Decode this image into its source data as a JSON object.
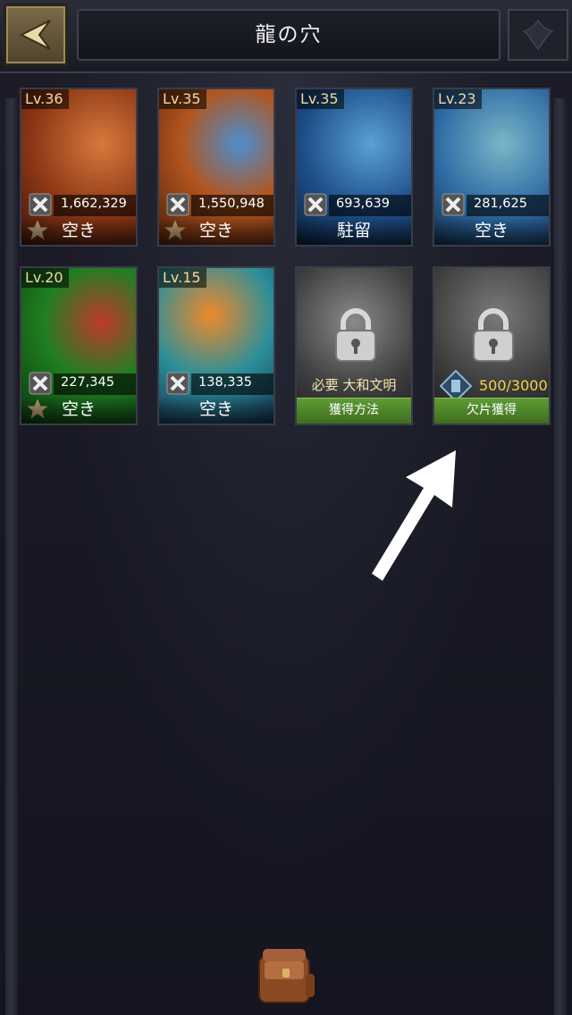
{
  "header": {
    "title": "龍の穴"
  },
  "dragons": [
    {
      "level": "Lv.36",
      "power": "1,662,329",
      "status": "空き",
      "starred": true,
      "palette": [
        "#c2531f",
        "#6b2a12"
      ]
    },
    {
      "level": "Lv.35",
      "power": "1,550,948",
      "status": "空き",
      "starred": true,
      "palette": [
        "#b8561e",
        "#5a2a12"
      ]
    },
    {
      "level": "Lv.35",
      "power": "693,639",
      "status": "駐留",
      "starred": false,
      "palette": [
        "#2f6fb0",
        "#102a4a"
      ]
    },
    {
      "level": "Lv.23",
      "power": "281,625",
      "status": "空き",
      "starred": false,
      "palette": [
        "#3b7fb6",
        "#173553"
      ]
    },
    {
      "level": "Lv.20",
      "power": "227,345",
      "status": "空き",
      "starred": true,
      "palette": [
        "#2e9c2a",
        "#0f3e10"
      ]
    },
    {
      "level": "Lv.15",
      "power": "138,335",
      "status": "空き",
      "starred": false,
      "palette": [
        "#3a78b8",
        "#15304e"
      ]
    }
  ],
  "locked": [
    {
      "requirement": "必要 大和文明",
      "button": "獲得方法"
    },
    {
      "fragments": "500/3000",
      "button": "欠片獲得"
    }
  ],
  "icons": {
    "back": "back-arrow-icon",
    "power": "crossed-hammers-icon",
    "star": "star-icon",
    "lock": "padlock-icon",
    "fragment": "dragon-fragment-icon",
    "bag": "inventory-bag-icon"
  }
}
